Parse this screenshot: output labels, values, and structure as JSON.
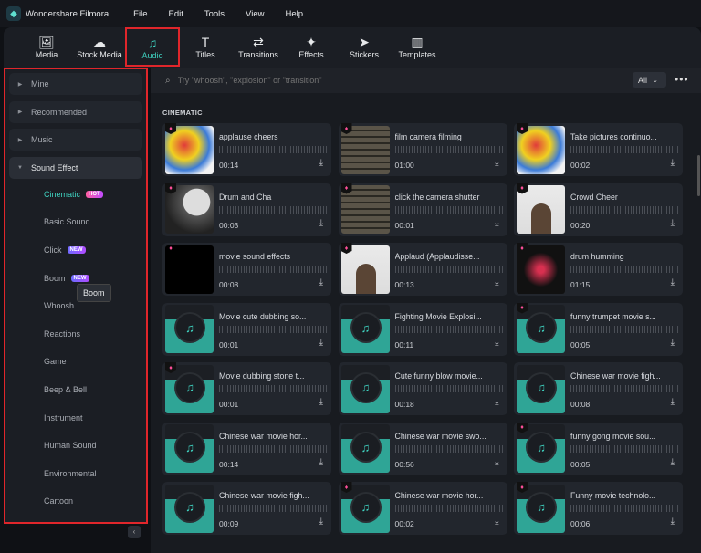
{
  "app": {
    "title": "Wondershare Filmora",
    "menu": [
      "File",
      "Edit",
      "Tools",
      "View",
      "Help"
    ]
  },
  "toolbar": [
    {
      "label": "Media",
      "icon": "🖼"
    },
    {
      "label": "Stock Media",
      "icon": "☁"
    },
    {
      "label": "Audio",
      "icon": "♫",
      "active": true
    },
    {
      "label": "Titles",
      "icon": "T"
    },
    {
      "label": "Transitions",
      "icon": "⇄"
    },
    {
      "label": "Effects",
      "icon": "✦"
    },
    {
      "label": "Stickers",
      "icon": "➤"
    },
    {
      "label": "Templates",
      "icon": "▥"
    }
  ],
  "sidebar": {
    "groups": [
      "Mine",
      "Recommended",
      "Music",
      "Sound Effect"
    ],
    "subs": [
      {
        "label": "Cinematic",
        "badge": "HOT",
        "active": true
      },
      {
        "label": "Basic Sound"
      },
      {
        "label": "Click",
        "badge": "NEW"
      },
      {
        "label": "Boom",
        "badge": "NEW"
      },
      {
        "label": "Whoosh"
      },
      {
        "label": "Reactions"
      },
      {
        "label": "Game"
      },
      {
        "label": "Beep & Bell"
      },
      {
        "label": "Instrument"
      },
      {
        "label": "Human Sound"
      },
      {
        "label": "Environmental"
      },
      {
        "label": "Cartoon"
      }
    ],
    "tooltip": "Boom"
  },
  "search": {
    "placeholder": "Try \"whoosh\", \"explosion\" or \"transition\"",
    "filter": "All"
  },
  "section": "CINEMATIC",
  "items": [
    {
      "name": "applause cheers",
      "duration": "00:14",
      "thumb": 0,
      "premium": "badge"
    },
    {
      "name": "film camera filming",
      "duration": "01:00",
      "thumb": 1,
      "premium": "badge"
    },
    {
      "name": "Take pictures continuo...",
      "duration": "00:02",
      "thumb": 0,
      "premium": "badge"
    },
    {
      "name": "Drum and Cha",
      "duration": "00:03",
      "thumb": 2,
      "premium": "badge"
    },
    {
      "name": "click the camera shutter",
      "duration": "00:01",
      "thumb": 1,
      "premium": "badge"
    },
    {
      "name": "Crowd Cheer",
      "duration": "00:20",
      "thumb": 4,
      "premium": "badge"
    },
    {
      "name": "movie sound effects",
      "duration": "00:08",
      "thumb": 3,
      "premium": "plain"
    },
    {
      "name": "Applaud (Applaudisse...",
      "duration": "00:13",
      "thumb": 4,
      "premium": "badge"
    },
    {
      "name": "drum humming",
      "duration": "01:15",
      "thumb": 5,
      "premium": "badge"
    },
    {
      "name": "Movie cute dubbing so...",
      "duration": "00:01",
      "thumb": 6,
      "premium": ""
    },
    {
      "name": "Fighting Movie Explosi...",
      "duration": "00:11",
      "thumb": 6,
      "premium": ""
    },
    {
      "name": "funny trumpet movie s...",
      "duration": "00:05",
      "thumb": 6,
      "premium": "badge"
    },
    {
      "name": "Movie dubbing stone t...",
      "duration": "00:01",
      "thumb": 6,
      "premium": "badge"
    },
    {
      "name": "Cute funny blow movie...",
      "duration": "00:18",
      "thumb": 6,
      "premium": ""
    },
    {
      "name": "Chinese war movie figh...",
      "duration": "00:08",
      "thumb": 6,
      "premium": ""
    },
    {
      "name": "Chinese war movie hor...",
      "duration": "00:14",
      "thumb": 6,
      "premium": ""
    },
    {
      "name": "Chinese war movie swo...",
      "duration": "00:56",
      "thumb": 6,
      "premium": ""
    },
    {
      "name": "funny gong movie sou...",
      "duration": "00:05",
      "thumb": 6,
      "premium": "badge"
    },
    {
      "name": "Chinese war movie figh...",
      "duration": "00:09",
      "thumb": 6,
      "premium": ""
    },
    {
      "name": "Chinese war movie hor...",
      "duration": "00:02",
      "thumb": 6,
      "premium": "badge"
    },
    {
      "name": "Funny movie technolo...",
      "duration": "00:06",
      "thumb": 6,
      "premium": "badge"
    }
  ]
}
